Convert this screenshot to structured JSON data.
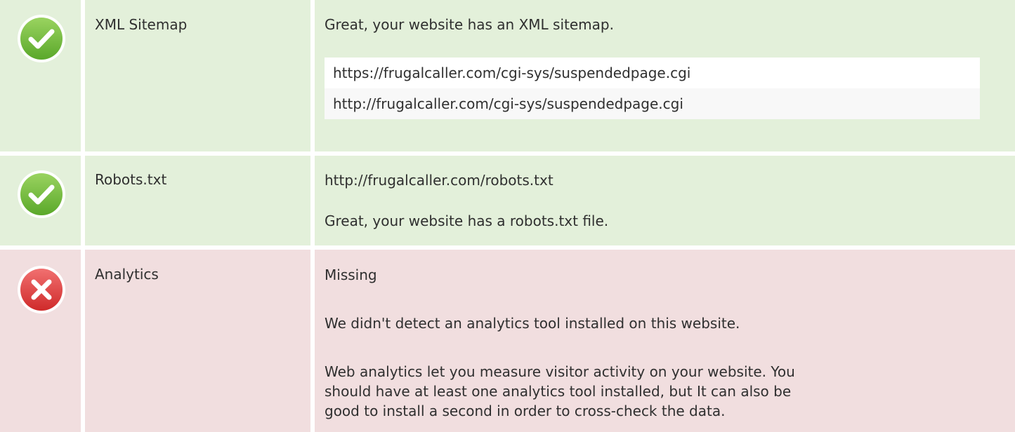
{
  "rows": [
    {
      "status": "pass",
      "status_icon": "check-circle-icon",
      "name": "XML Sitemap",
      "message": "Great, your website has an XML sitemap.",
      "urls": [
        "https://frugalcaller.com/cgi-sys/suspendedpage.cgi",
        "http://frugalcaller.com/cgi-sys/suspendedpage.cgi"
      ]
    },
    {
      "status": "pass",
      "status_icon": "check-circle-icon",
      "name": "Robots.txt",
      "url": "http://frugalcaller.com/robots.txt",
      "message": "Great, your website has a robots.txt file."
    },
    {
      "status": "fail",
      "status_icon": "x-circle-icon",
      "name": "Analytics",
      "state": "Missing",
      "message": "We didn't detect an analytics tool installed on this website.",
      "detail_lines": [
        "Web analytics let you measure visitor activity on your website. You",
        "should have at least one analytics tool installed, but It can also be",
        "good to install a second in order to cross-check the data."
      ]
    }
  ],
  "colors": {
    "pass_bg": "#e3f0da",
    "fail_bg": "#f1dedf",
    "pass_icon": "#71bf3a",
    "fail_icon": "#de3a3a"
  }
}
